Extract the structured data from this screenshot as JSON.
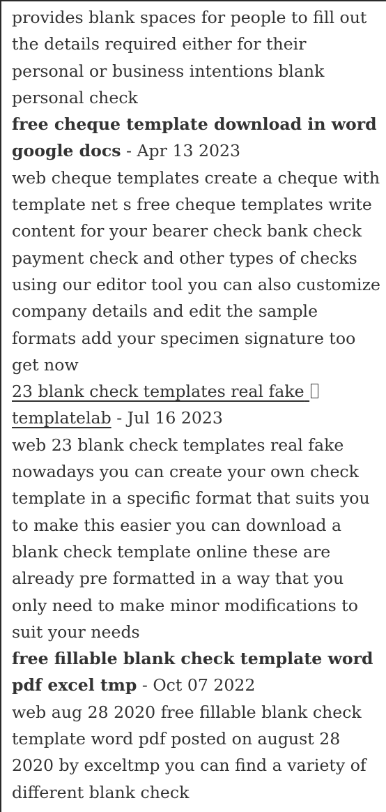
{
  "article": {
    "p1": "provides blank spaces for people to fill out the details required either for their personal or business intentions blank personal check",
    "h1": {
      "title": "free cheque template download in word google docs",
      "date": " - Apr 13 2023"
    },
    "p2": "web cheque templates create a cheque with template net s free cheque templates write content for your bearer check bank check payment check and other types of checks using our editor tool you can also customize company details and edit the sample formats add your specimen signature too get now",
    "h2": {
      "title": "23 blank check templates real fake",
      "title_line2": "templatelab",
      "date": " - Jul 16 2023"
    },
    "p3": "web 23 blank check templates real fake nowadays you can create your own check template in a specific format that suits you to make this easier you can download a blank check template online these are already pre formatted in a way that you only need to make minor modifications to suit your needs",
    "h3": {
      "title": "free fillable blank check template word pdf excel tmp",
      "date": " - Oct 07 2022"
    },
    "p4": "web aug 28 2020  free fillable blank check template word pdf posted on august 28 2020 by exceltmp you can find a variety of different blank check"
  }
}
